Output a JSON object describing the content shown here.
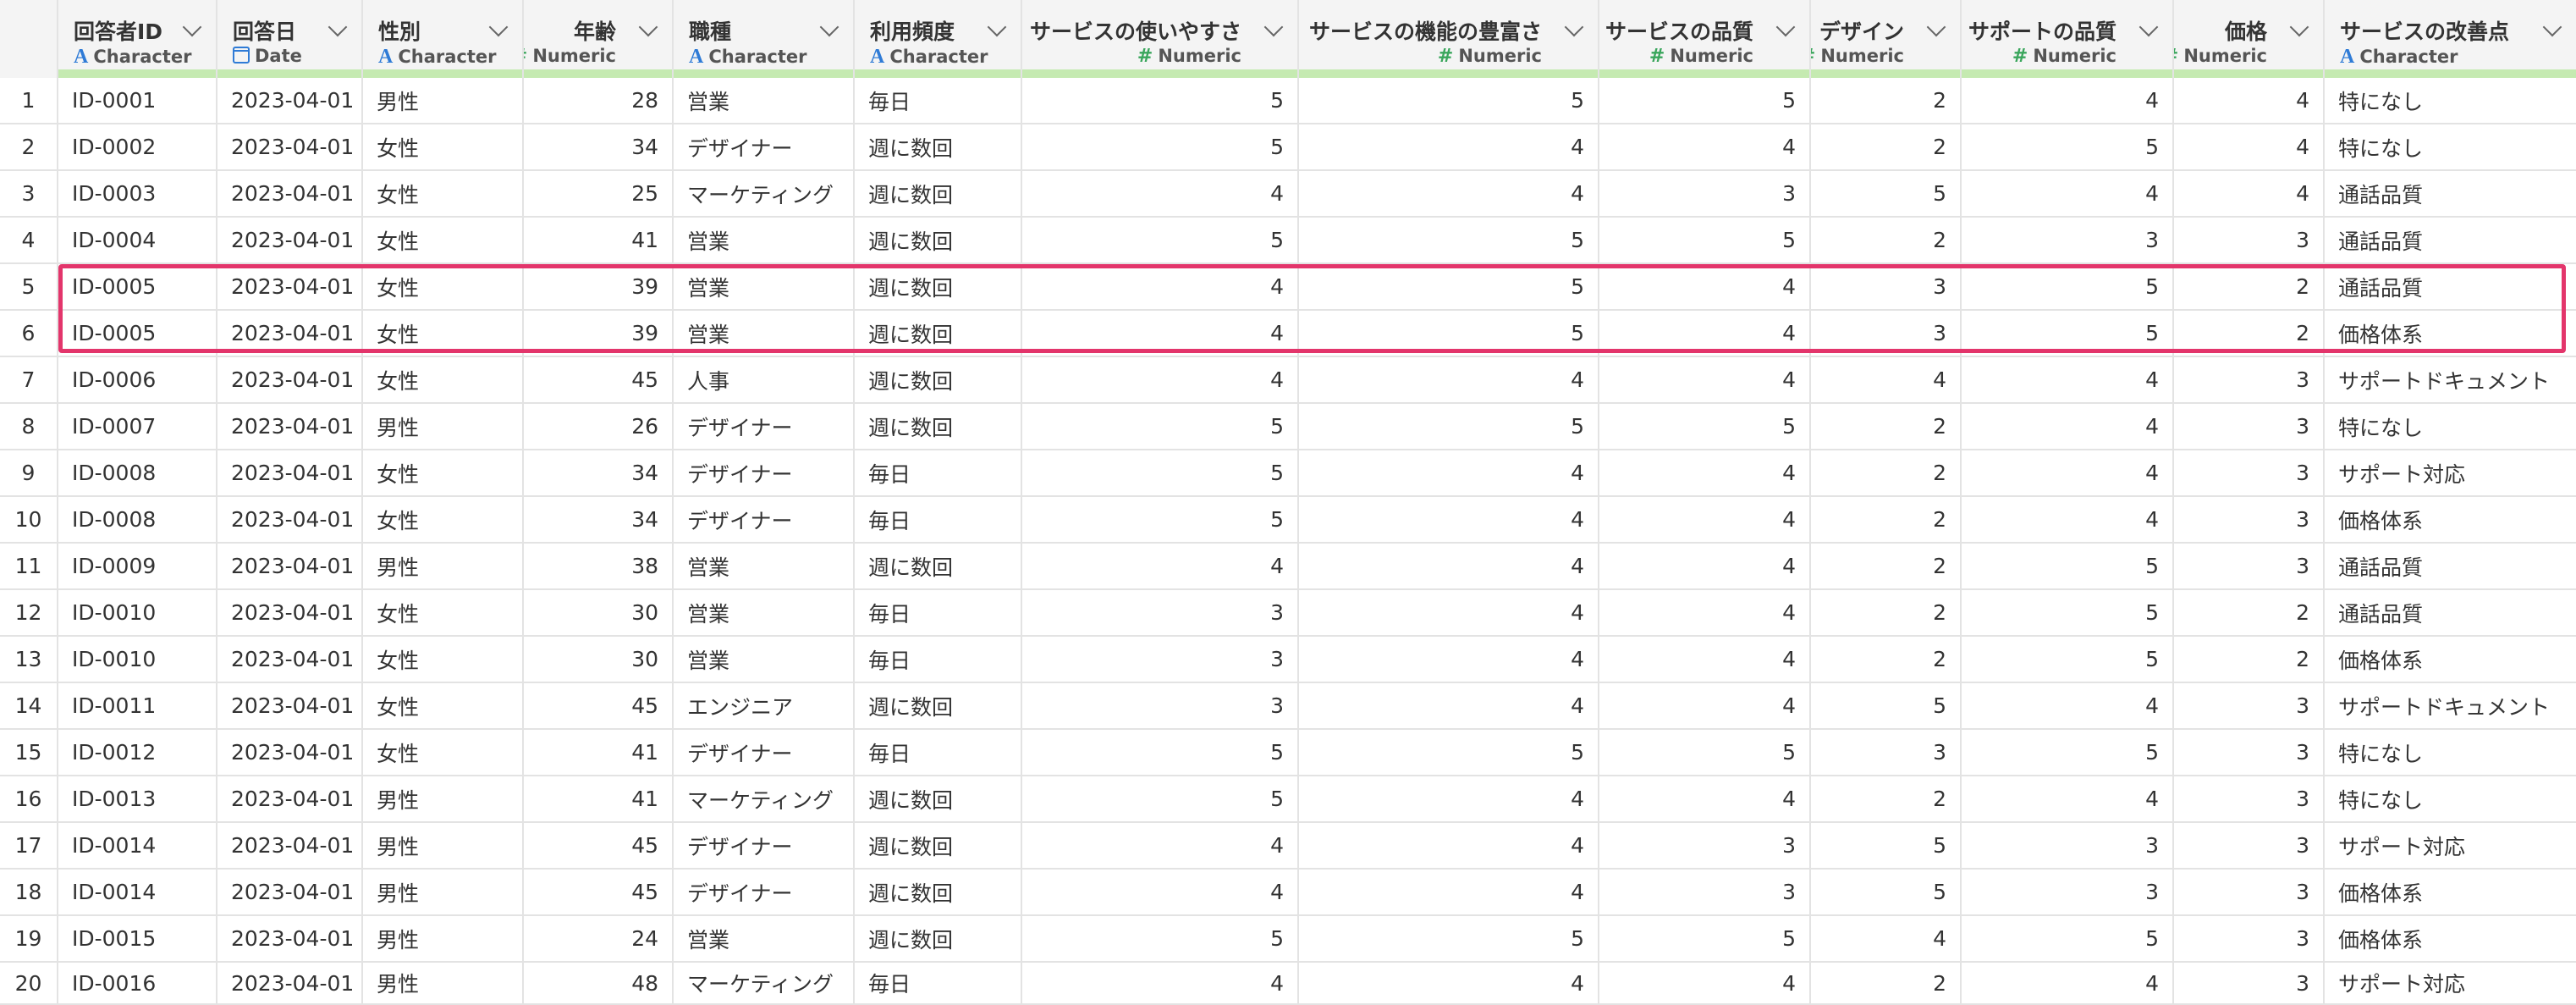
{
  "colors": {
    "header_bg": "#f4f4f4",
    "header_bar": "#c5eab1",
    "character_icon": "#2f7bd6",
    "numeric_icon": "#3aa65c",
    "highlight": "#e3356b"
  },
  "columns": [
    {
      "name": "回答者ID",
      "type": "Character",
      "icon": "character-icon",
      "align": "l"
    },
    {
      "name": "回答日",
      "type": "Date",
      "icon": "calendar-icon",
      "align": "l"
    },
    {
      "name": "性別",
      "type": "Character",
      "icon": "character-icon",
      "align": "l"
    },
    {
      "name": "年齢",
      "type": "Numeric",
      "icon": "numeric-icon",
      "align": "r"
    },
    {
      "name": "職種",
      "type": "Character",
      "icon": "character-icon",
      "align": "l"
    },
    {
      "name": "利用頻度",
      "type": "Character",
      "icon": "character-icon",
      "align": "l"
    },
    {
      "name": "サービスの使いやすさ",
      "type": "Numeric",
      "icon": "numeric-icon",
      "align": "r"
    },
    {
      "name": "サービスの機能の豊富さ",
      "type": "Numeric",
      "icon": "numeric-icon",
      "align": "r"
    },
    {
      "name": "サービスの品質",
      "type": "Numeric",
      "icon": "numeric-icon",
      "align": "r"
    },
    {
      "name": "デザイン",
      "type": "Numeric",
      "icon": "numeric-icon",
      "align": "r"
    },
    {
      "name": "サポートの品質",
      "type": "Numeric",
      "icon": "numeric-icon",
      "align": "r"
    },
    {
      "name": "価格",
      "type": "Numeric",
      "icon": "numeric-icon",
      "align": "r"
    },
    {
      "name": "サービスの改善点",
      "type": "Character",
      "icon": "character-icon",
      "align": "l"
    }
  ],
  "rows": [
    [
      "1",
      "ID-0001",
      "2023-04-01",
      "男性",
      "28",
      "営業",
      "毎日",
      "5",
      "5",
      "5",
      "2",
      "4",
      "4",
      "特になし"
    ],
    [
      "2",
      "ID-0002",
      "2023-04-01",
      "女性",
      "34",
      "デザイナー",
      "週に数回",
      "5",
      "4",
      "4",
      "2",
      "5",
      "4",
      "特になし"
    ],
    [
      "3",
      "ID-0003",
      "2023-04-01",
      "女性",
      "25",
      "マーケティング",
      "週に数回",
      "4",
      "4",
      "3",
      "5",
      "4",
      "4",
      "通話品質"
    ],
    [
      "4",
      "ID-0004",
      "2023-04-01",
      "女性",
      "41",
      "営業",
      "週に数回",
      "5",
      "5",
      "5",
      "2",
      "3",
      "3",
      "通話品質"
    ],
    [
      "5",
      "ID-0005",
      "2023-04-01",
      "女性",
      "39",
      "営業",
      "週に数回",
      "4",
      "5",
      "4",
      "3",
      "5",
      "2",
      "通話品質"
    ],
    [
      "6",
      "ID-0005",
      "2023-04-01",
      "女性",
      "39",
      "営業",
      "週に数回",
      "4",
      "5",
      "4",
      "3",
      "5",
      "2",
      "価格体系"
    ],
    [
      "7",
      "ID-0006",
      "2023-04-01",
      "女性",
      "45",
      "人事",
      "週に数回",
      "4",
      "4",
      "4",
      "4",
      "4",
      "3",
      "サポートドキュメント"
    ],
    [
      "8",
      "ID-0007",
      "2023-04-01",
      "男性",
      "26",
      "デザイナー",
      "週に数回",
      "5",
      "5",
      "5",
      "2",
      "4",
      "3",
      "特になし"
    ],
    [
      "9",
      "ID-0008",
      "2023-04-01",
      "女性",
      "34",
      "デザイナー",
      "毎日",
      "5",
      "4",
      "4",
      "2",
      "4",
      "3",
      "サポート対応"
    ],
    [
      "10",
      "ID-0008",
      "2023-04-01",
      "女性",
      "34",
      "デザイナー",
      "毎日",
      "5",
      "4",
      "4",
      "2",
      "4",
      "3",
      "価格体系"
    ],
    [
      "11",
      "ID-0009",
      "2023-04-01",
      "男性",
      "38",
      "営業",
      "週に数回",
      "4",
      "4",
      "4",
      "2",
      "5",
      "3",
      "通話品質"
    ],
    [
      "12",
      "ID-0010",
      "2023-04-01",
      "女性",
      "30",
      "営業",
      "毎日",
      "3",
      "4",
      "4",
      "2",
      "5",
      "2",
      "通話品質"
    ],
    [
      "13",
      "ID-0010",
      "2023-04-01",
      "女性",
      "30",
      "営業",
      "毎日",
      "3",
      "4",
      "4",
      "2",
      "5",
      "2",
      "価格体系"
    ],
    [
      "14",
      "ID-0011",
      "2023-04-01",
      "女性",
      "45",
      "エンジニア",
      "週に数回",
      "3",
      "4",
      "4",
      "5",
      "4",
      "3",
      "サポートドキュメント"
    ],
    [
      "15",
      "ID-0012",
      "2023-04-01",
      "女性",
      "41",
      "デザイナー",
      "毎日",
      "5",
      "5",
      "5",
      "3",
      "5",
      "3",
      "特になし"
    ],
    [
      "16",
      "ID-0013",
      "2023-04-01",
      "男性",
      "41",
      "マーケティング",
      "週に数回",
      "5",
      "4",
      "4",
      "2",
      "4",
      "3",
      "特になし"
    ],
    [
      "17",
      "ID-0014",
      "2023-04-01",
      "男性",
      "45",
      "デザイナー",
      "週に数回",
      "4",
      "4",
      "3",
      "5",
      "3",
      "3",
      "サポート対応"
    ],
    [
      "18",
      "ID-0014",
      "2023-04-01",
      "男性",
      "45",
      "デザイナー",
      "週に数回",
      "4",
      "4",
      "3",
      "5",
      "3",
      "3",
      "価格体系"
    ],
    [
      "19",
      "ID-0015",
      "2023-04-01",
      "男性",
      "24",
      "営業",
      "週に数回",
      "5",
      "5",
      "5",
      "4",
      "5",
      "3",
      "価格体系"
    ],
    [
      "20",
      "ID-0016",
      "2023-04-01",
      "男性",
      "48",
      "マーケティング",
      "毎日",
      "4",
      "4",
      "4",
      "2",
      "4",
      "3",
      "サポート対応"
    ]
  ],
  "highlighted_rows": [
    "5",
    "6"
  ]
}
